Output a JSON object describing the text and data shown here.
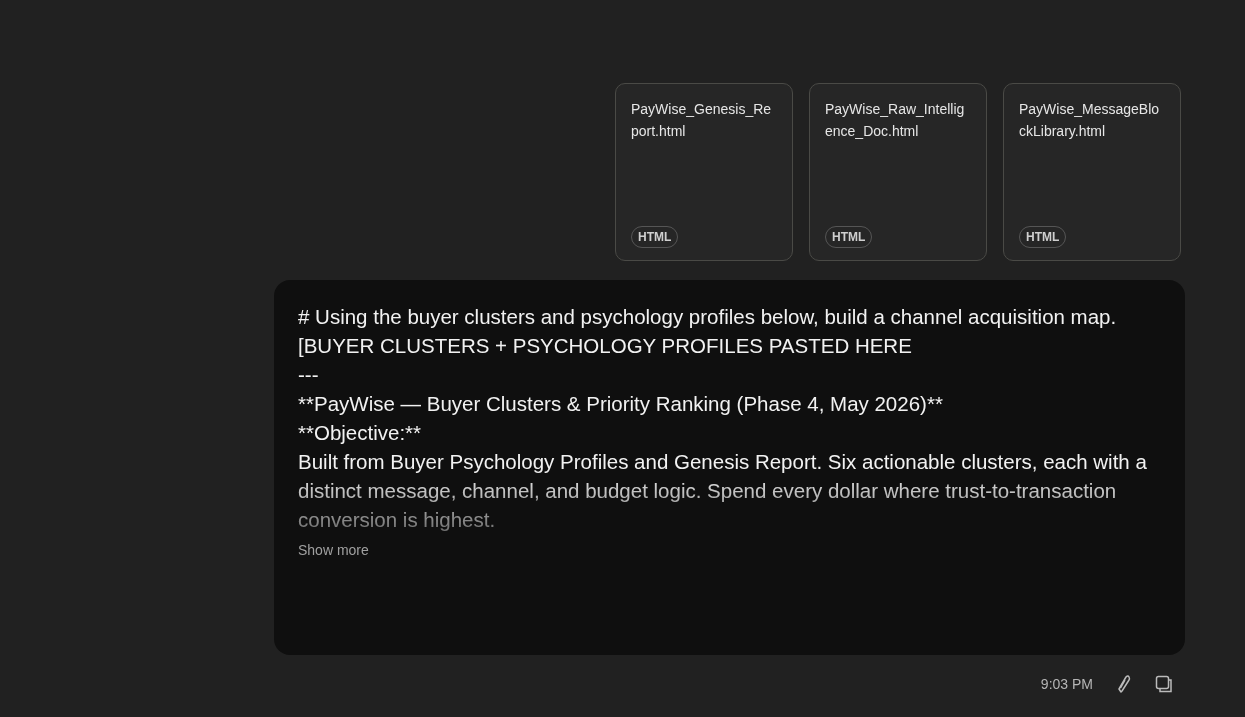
{
  "attachments": [
    {
      "name": "PayWise_Genesis_Report.html",
      "type": "HTML"
    },
    {
      "name": "PayWise_Raw_Intelligence_Doc.html",
      "type": "HTML"
    },
    {
      "name": "PayWise_MessageBlockLibrary.html",
      "type": "HTML"
    }
  ],
  "message": {
    "lines": [
      "# Using the buyer clusters and psychology profiles below, build a channel acquisition map.",
      "[BUYER CLUSTERS + PSYCHOLOGY PROFILES PASTED HERE",
      "---",
      "**PayWise — Buyer Clusters & Priority Ranking (Phase 4, May 2026)**",
      "**Objective:**",
      "Built from Buyer Psychology Profiles and Genesis Report. Six actionable clusters, each with a distinct message, channel, and budget logic. Spend every dollar where trust-to-transaction conversion is highest."
    ],
    "show_more": "Show more"
  },
  "footer": {
    "time": "9:03 PM"
  }
}
